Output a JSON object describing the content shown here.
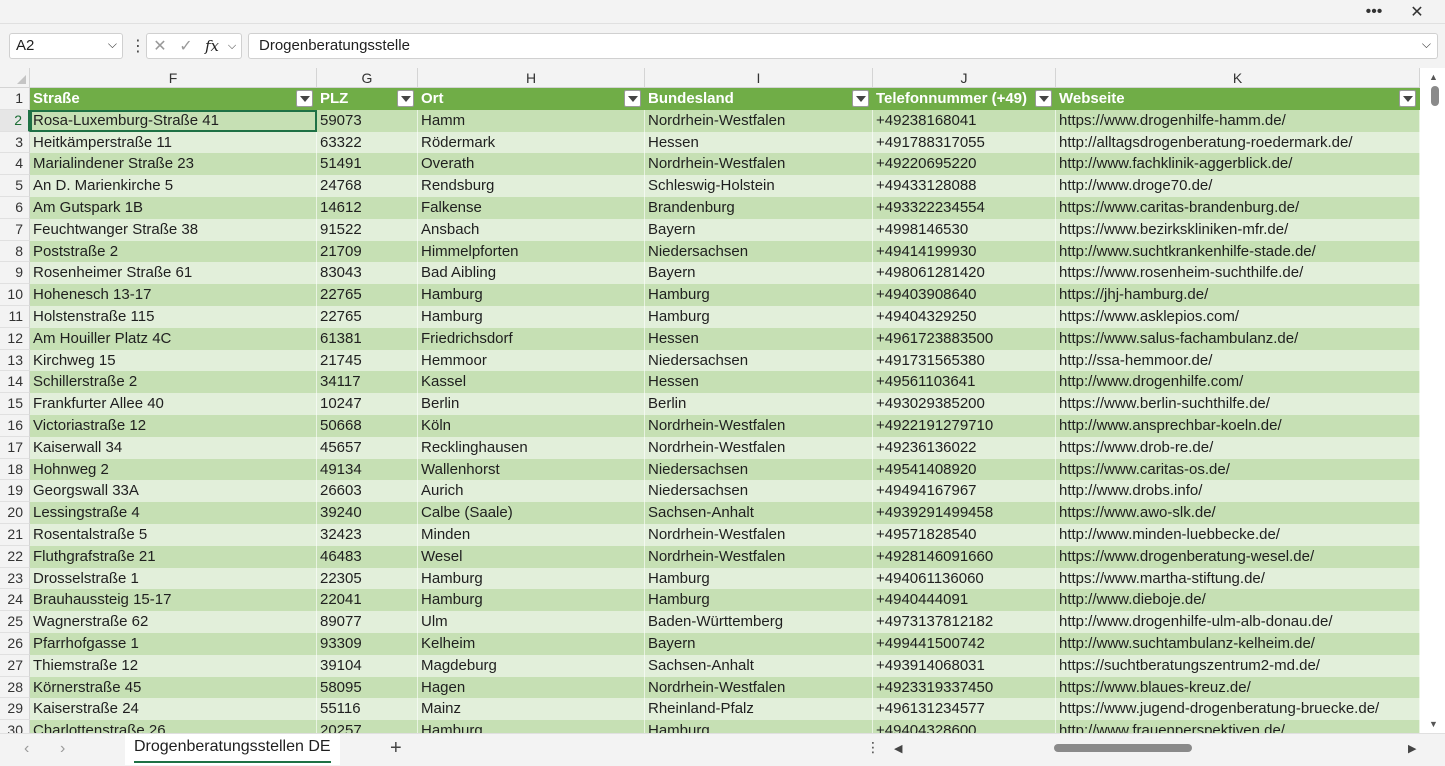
{
  "window": {
    "more_label": "•••",
    "close_label": "✕"
  },
  "formula_bar": {
    "name_box": "A2",
    "formula_value": "Drogenberatungsstelle",
    "cancel_icon": "✕",
    "enter_icon": "✓",
    "fx_label": "fx"
  },
  "sheet": {
    "column_letters": [
      "F",
      "G",
      "H",
      "I",
      "J",
      "K"
    ],
    "headers": [
      "Straße",
      "PLZ",
      "Ort",
      "Bundesland",
      "Telefonnummer (+49)",
      "Webseite"
    ],
    "active_row": 2,
    "rows": [
      [
        "Rosa-Luxemburg-Straße 41",
        "59073",
        "Hamm",
        "Nordrhein-Westfalen",
        "+49238168041",
        "https://www.drogenhilfe-hamm.de/"
      ],
      [
        "Heitkämperstraße 11",
        "63322",
        "Rödermark",
        "Hessen",
        "+491788317055",
        "http://alltagsdrogenberatung-roedermark.de/"
      ],
      [
        "Marialindener Straße 23",
        "51491",
        "Overath",
        "Nordrhein-Westfalen",
        "+49220695220",
        "http://www.fachklinik-aggerblick.de/"
      ],
      [
        "An D. Marienkirche 5",
        "24768",
        "Rendsburg",
        "Schleswig-Holstein",
        "+49433128088",
        "http://www.droge70.de/"
      ],
      [
        "Am Gutspark 1B",
        "14612",
        "Falkense",
        "Brandenburg",
        "+493322234554",
        "https://www.caritas-brandenburg.de/"
      ],
      [
        "Feuchtwanger Straße 38",
        "91522",
        "Ansbach",
        "Bayern",
        "+4998146530",
        "https://www.bezirkskliniken-mfr.de/"
      ],
      [
        "Poststraße 2",
        "21709",
        "Himmelpforten",
        "Niedersachsen",
        "+49414199930",
        "http://www.suchtkrankenhilfe-stade.de/"
      ],
      [
        "Rosenheimer Straße 61",
        "83043",
        "Bad Aibling",
        "Bayern",
        "+498061281420",
        "https://www.rosenheim-suchthilfe.de/"
      ],
      [
        "Hohenesch 13-17",
        "22765",
        "Hamburg",
        "Hamburg",
        "+49403908640",
        "https://jhj-hamburg.de/"
      ],
      [
        "Holstenstraße 115",
        "22765",
        "Hamburg",
        "Hamburg",
        "+49404329250",
        "https://www.asklepios.com/"
      ],
      [
        "Am Houiller Platz 4C",
        "61381",
        "Friedrichsdorf",
        "Hessen",
        "+4961723883500",
        "https://www.salus-fachambulanz.de/"
      ],
      [
        "Kirchweg 15",
        "21745",
        "Hemmoor",
        "Niedersachsen",
        "+491731565380",
        "http://ssa-hemmoor.de/"
      ],
      [
        "Schillerstraße 2",
        "34117",
        "Kassel",
        "Hessen",
        "+49561103641",
        "http://www.drogenhilfe.com/"
      ],
      [
        "Frankfurter Allee 40",
        "10247",
        "Berlin",
        "Berlin",
        "+493029385200",
        "https://www.berlin-suchthilfe.de/"
      ],
      [
        "Victoriastraße 12",
        "50668",
        "Köln",
        "Nordrhein-Westfalen",
        "+4922191279710",
        "http://www.ansprechbar-koeln.de/"
      ],
      [
        "Kaiserwall 34",
        "45657",
        "Recklinghausen",
        "Nordrhein-Westfalen",
        "+49236136022",
        "https://www.drob-re.de/"
      ],
      [
        "Hohnweg 2",
        "49134",
        "Wallenhorst",
        "Niedersachsen",
        "+49541408920",
        "https://www.caritas-os.de/"
      ],
      [
        "Georgswall 33A",
        "26603",
        "Aurich",
        "Niedersachsen",
        "+49494167967",
        "http://www.drobs.info/"
      ],
      [
        "Lessingstraße 4",
        "39240",
        "Calbe (Saale)",
        "Sachsen-Anhalt",
        "+4939291499458",
        "https://www.awo-slk.de/"
      ],
      [
        "Rosentalstraße 5",
        "32423",
        "Minden",
        "Nordrhein-Westfalen",
        "+49571828540",
        "http://www.minden-luebbecke.de/"
      ],
      [
        "Fluthgrafstraße 21",
        "46483",
        "Wesel",
        "Nordrhein-Westfalen",
        "+4928146091660",
        "https://www.drogenberatung-wesel.de/"
      ],
      [
        "Drosselstraße 1",
        "22305",
        "Hamburg",
        "Hamburg",
        "+494061136060",
        "https://www.martha-stiftung.de/"
      ],
      [
        "Brauhaussteig 15-17",
        "22041",
        "Hamburg",
        "Hamburg",
        "+4940444091",
        "http://www.dieboje.de/"
      ],
      [
        "Wagnerstraße 62",
        "89077",
        "Ulm",
        "Baden-Württemberg",
        "+4973137812182",
        "http://www.drogenhilfe-ulm-alb-donau.de/"
      ],
      [
        "Pfarrhofgasse 1",
        "93309",
        "Kelheim",
        "Bayern",
        "+499441500742",
        "http://www.suchtambulanz-kelheim.de/"
      ],
      [
        "Thiemstraße 12",
        "39104",
        "Magdeburg",
        "Sachsen-Anhalt",
        "+493914068031",
        "https://suchtberatungszentrum2-md.de/"
      ],
      [
        "Körnerstraße 45",
        "58095",
        "Hagen",
        "Nordrhein-Westfalen",
        "+4923319337450",
        "https://www.blaues-kreuz.de/"
      ],
      [
        "Kaiserstraße 24",
        "55116",
        "Mainz",
        "Rheinland-Pfalz",
        "+496131234577",
        "https://www.jugend-drogenberatung-bruecke.de/"
      ],
      [
        "Charlottenstraße 26",
        "20257",
        "Hamburg",
        "Hamburg",
        "+49404328600",
        "http://www.frauenperspektiven.de/"
      ]
    ]
  },
  "bottom": {
    "sheet_tab": "Drogenberatungsstellen DE",
    "add_sheet": "+",
    "more_label": "⋮"
  }
}
